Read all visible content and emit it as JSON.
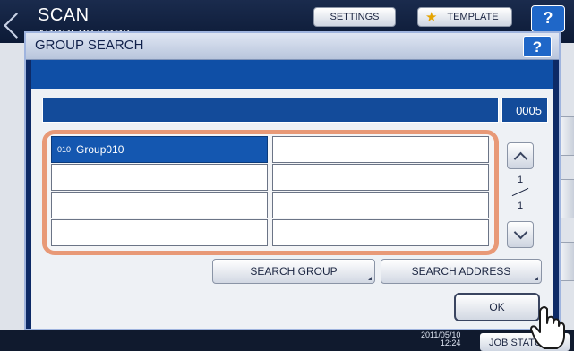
{
  "background": {
    "title": "SCAN",
    "subtitle": "ADDRESS BOOK",
    "settings_label": "SETTINGS",
    "template_label": "TEMPLATE",
    "help_label": "?",
    "datetime_line1": "2011/05/10",
    "datetime_line2": "12:24",
    "job_status_label": "JOB STATUS"
  },
  "dialog": {
    "title": "GROUP SEARCH",
    "help_label": "?",
    "search_value": "",
    "count": "0005",
    "list": [
      {
        "number": "010",
        "name": "Group010",
        "selected": true
      },
      {
        "number": "",
        "name": "",
        "selected": false
      },
      {
        "number": "",
        "name": "",
        "selected": false
      },
      {
        "number": "",
        "name": "",
        "selected": false
      },
      {
        "number": "",
        "name": "",
        "selected": false
      },
      {
        "number": "",
        "name": "",
        "selected": false
      },
      {
        "number": "",
        "name": "",
        "selected": false
      },
      {
        "number": "",
        "name": "",
        "selected": false
      }
    ],
    "pager": {
      "current": "1",
      "total": "1"
    },
    "search_group_label": "SEARCH GROUP",
    "search_address_label": "SEARCH ADDRESS",
    "ok_label": "OK"
  },
  "colors": {
    "highlight_frame": "#e89977",
    "selected_row": "#1457b0",
    "dialog_band": "#0f4fa6"
  }
}
